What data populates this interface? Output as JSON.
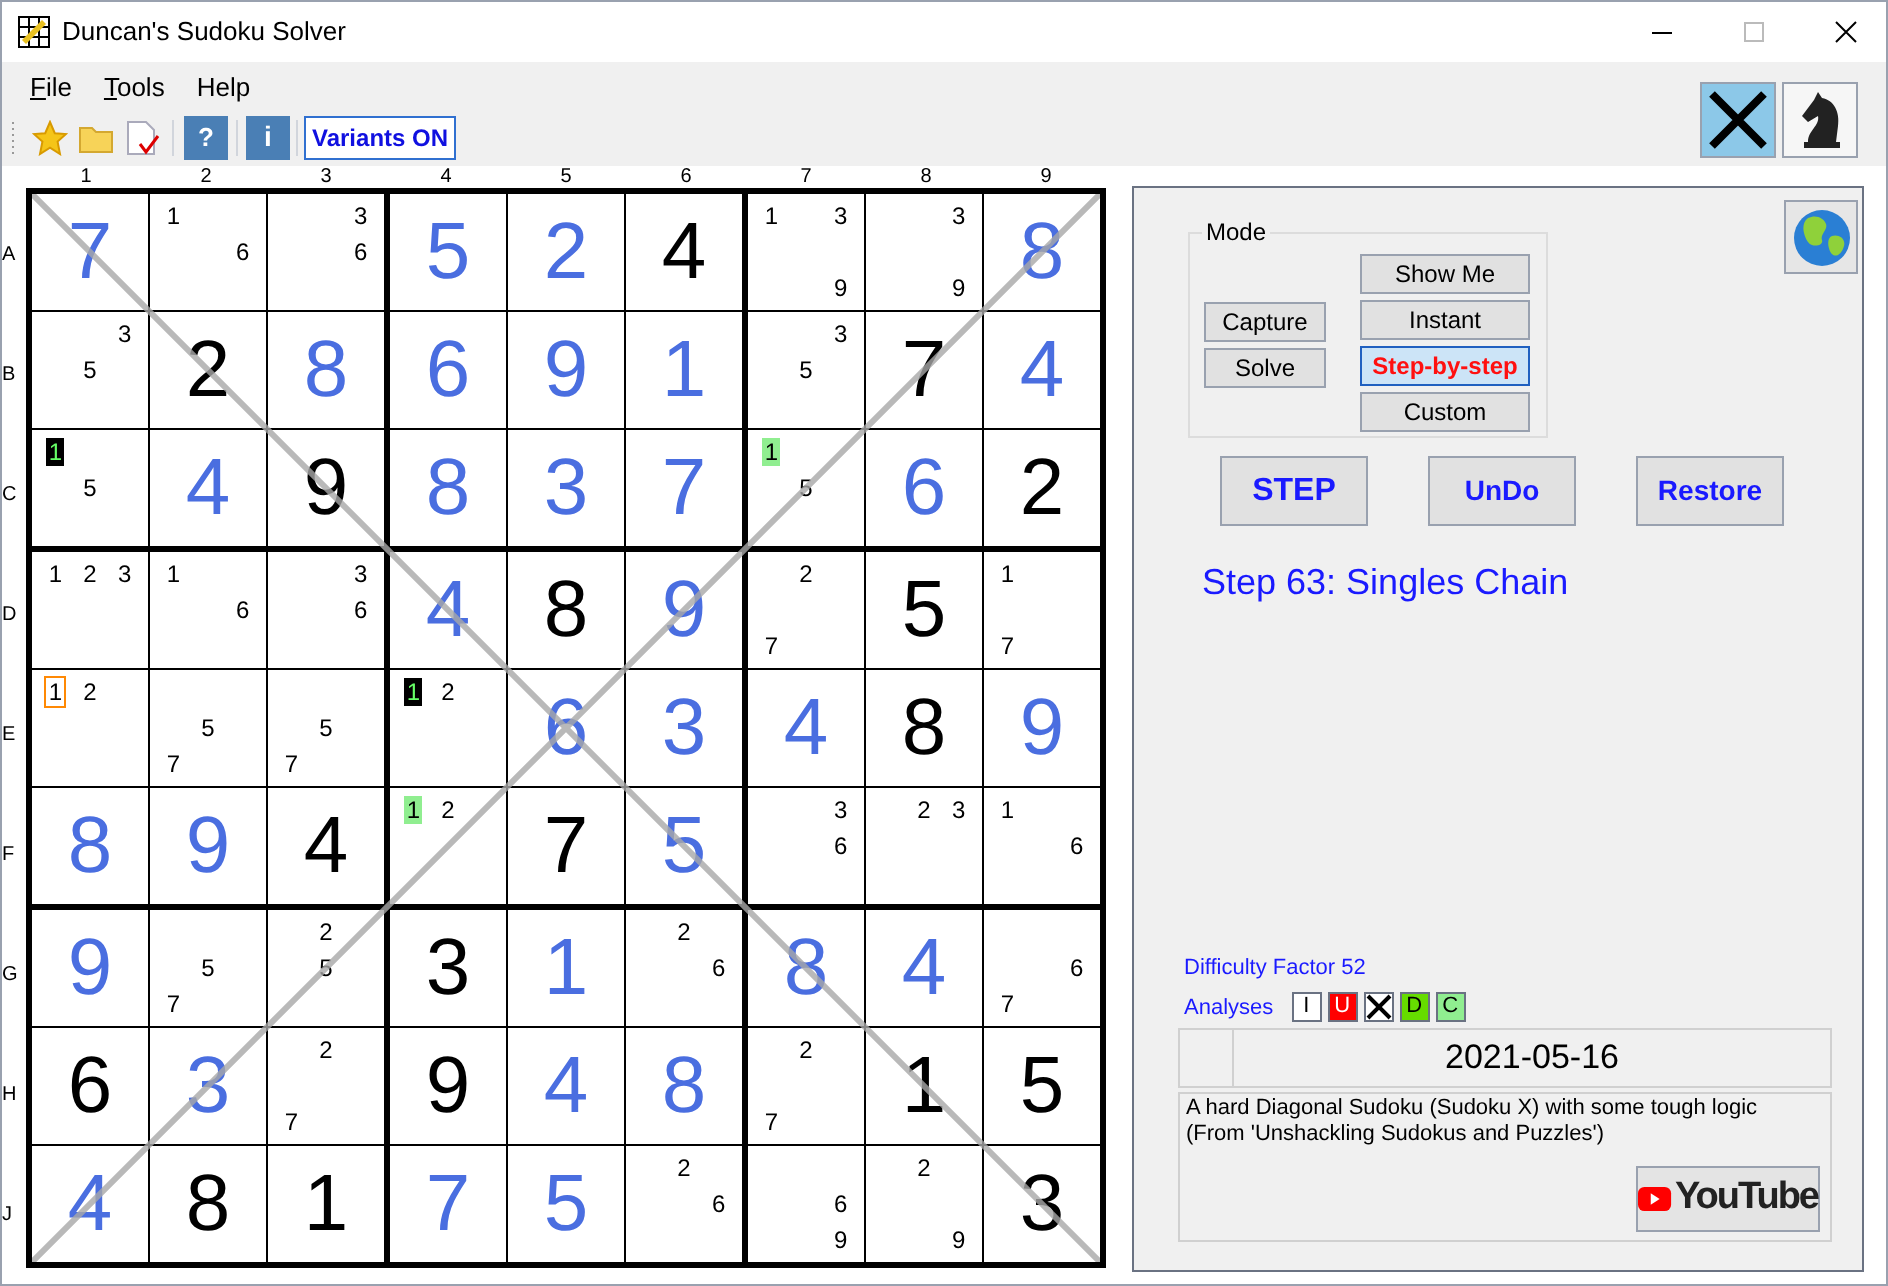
{
  "window": {
    "title": "Duncan's Sudoku Solver"
  },
  "menu": [
    {
      "label": "File",
      "mnemonic": true
    },
    {
      "label": "Tools",
      "mnemonic": true
    },
    {
      "label": "Help",
      "mnemonic": false
    }
  ],
  "toolbar": {
    "help": "?",
    "info": "i",
    "variants": "Variants ON"
  },
  "grid": {
    "column_labels": [
      "1",
      "2",
      "3",
      "4",
      "5",
      "6",
      "7",
      "8",
      "9"
    ],
    "row_labels": [
      "A",
      "B",
      "C",
      "D",
      "E",
      "F",
      "G",
      "H",
      "J"
    ],
    "rows": [
      {
        "cells": [
          {
            "kind": "solved",
            "value": "7"
          },
          {
            "kind": "candidates",
            "candidates": [
              {
                "text": "1",
                "kind": "plain"
              },
              {
                "text": "6",
                "kind": "plain"
              }
            ]
          },
          {
            "kind": "candidates",
            "candidates": [
              {
                "text": "3",
                "kind": "plain"
              },
              {
                "text": "6",
                "kind": "plain"
              }
            ]
          },
          {
            "kind": "solved",
            "value": "5"
          },
          {
            "kind": "solved",
            "value": "2"
          },
          {
            "kind": "given",
            "value": "4"
          },
          {
            "kind": "candidates",
            "candidates": [
              {
                "text": "1",
                "kind": "plain"
              },
              {
                "text": "3",
                "kind": "plain"
              },
              {
                "text": "9",
                "kind": "plain"
              }
            ]
          },
          {
            "kind": "candidates",
            "candidates": [
              {
                "text": "3",
                "kind": "plain"
              },
              {
                "text": "9",
                "kind": "plain"
              }
            ]
          },
          {
            "kind": "solved",
            "value": "8"
          }
        ]
      },
      {
        "cells": [
          {
            "kind": "candidates",
            "candidates": [
              {
                "text": "3",
                "kind": "plain"
              },
              {
                "text": "5",
                "kind": "plain"
              }
            ]
          },
          {
            "kind": "given",
            "value": "2"
          },
          {
            "kind": "solved",
            "value": "8"
          },
          {
            "kind": "solved",
            "value": "6"
          },
          {
            "kind": "solved",
            "value": "9"
          },
          {
            "kind": "solved",
            "value": "1"
          },
          {
            "kind": "candidates",
            "candidates": [
              {
                "text": "3",
                "kind": "plain"
              },
              {
                "text": "5",
                "kind": "plain"
              }
            ]
          },
          {
            "kind": "given",
            "value": "7"
          },
          {
            "kind": "solved",
            "value": "4"
          }
        ]
      },
      {
        "cells": [
          {
            "kind": "candidates",
            "candidates": [
              {
                "text": "1",
                "kind": "dark_highlight"
              },
              {
                "text": "5",
                "kind": "plain"
              }
            ]
          },
          {
            "kind": "solved",
            "value": "4"
          },
          {
            "kind": "given",
            "value": "9"
          },
          {
            "kind": "solved",
            "value": "8"
          },
          {
            "kind": "solved",
            "value": "3"
          },
          {
            "kind": "solved",
            "value": "7"
          },
          {
            "kind": "candidates",
            "candidates": [
              {
                "text": "1",
                "kind": "green_highlight"
              },
              {
                "text": "5",
                "kind": "plain"
              }
            ]
          },
          {
            "kind": "solved",
            "value": "6"
          },
          {
            "kind": "given",
            "value": "2"
          }
        ]
      },
      {
        "cells": [
          {
            "kind": "candidates",
            "candidates": [
              {
                "text": "1",
                "kind": "plain"
              },
              {
                "text": "2",
                "kind": "plain"
              },
              {
                "text": "3",
                "kind": "plain"
              }
            ]
          },
          {
            "kind": "candidates",
            "candidates": [
              {
                "text": "1",
                "kind": "plain"
              },
              {
                "text": "6",
                "kind": "plain"
              }
            ]
          },
          {
            "kind": "candidates",
            "candidates": [
              {
                "text": "3",
                "kind": "plain"
              },
              {
                "text": "6",
                "kind": "plain"
              }
            ]
          },
          {
            "kind": "solved",
            "value": "4"
          },
          {
            "kind": "given",
            "value": "8"
          },
          {
            "kind": "solved",
            "value": "9"
          },
          {
            "kind": "candidates",
            "candidates": [
              {
                "text": "2",
                "kind": "plain"
              },
              {
                "text": "7",
                "kind": "plain"
              }
            ]
          },
          {
            "kind": "given",
            "value": "5"
          },
          {
            "kind": "candidates",
            "candidates": [
              {
                "text": "1",
                "kind": "plain"
              },
              {
                "text": "7",
                "kind": "plain"
              }
            ]
          }
        ]
      },
      {
        "cells": [
          {
            "kind": "candidates",
            "candidates": [
              {
                "text": "1",
                "kind": "outlined"
              },
              {
                "text": "2",
                "kind": "plain"
              }
            ]
          },
          {
            "kind": "candidates",
            "candidates": [
              {
                "text": "5",
                "kind": "plain"
              },
              {
                "text": "7",
                "kind": "plain"
              }
            ]
          },
          {
            "kind": "candidates",
            "candidates": [
              {
                "text": "5",
                "kind": "plain"
              },
              {
                "text": "7",
                "kind": "plain"
              }
            ]
          },
          {
            "kind": "candidates",
            "candidates": [
              {
                "text": "1",
                "kind": "dark_highlight"
              },
              {
                "text": "2",
                "kind": "plain"
              }
            ]
          },
          {
            "kind": "solved",
            "value": "6"
          },
          {
            "kind": "solved",
            "value": "3"
          },
          {
            "kind": "solved",
            "value": "4"
          },
          {
            "kind": "given",
            "value": "8"
          },
          {
            "kind": "solved",
            "value": "9"
          }
        ]
      },
      {
        "cells": [
          {
            "kind": "solved",
            "value": "8"
          },
          {
            "kind": "solved",
            "value": "9"
          },
          {
            "kind": "given",
            "value": "4"
          },
          {
            "kind": "candidates",
            "candidates": [
              {
                "text": "1",
                "kind": "green_highlight"
              },
              {
                "text": "2",
                "kind": "plain"
              }
            ]
          },
          {
            "kind": "given",
            "value": "7"
          },
          {
            "kind": "solved",
            "value": "5"
          },
          {
            "kind": "candidates",
            "candidates": [
              {
                "text": "3",
                "kind": "plain"
              },
              {
                "text": "6",
                "kind": "plain"
              }
            ]
          },
          {
            "kind": "candidates",
            "candidates": [
              {
                "text": "2",
                "kind": "plain"
              },
              {
                "text": "3",
                "kind": "plain"
              }
            ]
          },
          {
            "kind": "candidates",
            "candidates": [
              {
                "text": "1",
                "kind": "plain"
              },
              {
                "text": "6",
                "kind": "plain"
              }
            ]
          }
        ]
      },
      {
        "cells": [
          {
            "kind": "solved",
            "value": "9"
          },
          {
            "kind": "candidates",
            "candidates": [
              {
                "text": "5",
                "kind": "plain"
              },
              {
                "text": "7",
                "kind": "plain"
              }
            ]
          },
          {
            "kind": "candidates",
            "candidates": [
              {
                "text": "2",
                "kind": "plain"
              },
              {
                "text": "5",
                "kind": "plain"
              }
            ]
          },
          {
            "kind": "given",
            "value": "3"
          },
          {
            "kind": "solved",
            "value": "1"
          },
          {
            "kind": "candidates",
            "candidates": [
              {
                "text": "2",
                "kind": "plain"
              },
              {
                "text": "6",
                "kind": "plain"
              }
            ]
          },
          {
            "kind": "solved",
            "value": "8"
          },
          {
            "kind": "solved",
            "value": "4"
          },
          {
            "kind": "candidates",
            "candidates": [
              {
                "text": "6",
                "kind": "plain"
              },
              {
                "text": "7",
                "kind": "plain"
              }
            ]
          }
        ]
      },
      {
        "cells": [
          {
            "kind": "given",
            "value": "6"
          },
          {
            "kind": "solved",
            "value": "3"
          },
          {
            "kind": "candidates",
            "candidates": [
              {
                "text": "2",
                "kind": "plain"
              },
              {
                "text": "7",
                "kind": "plain"
              }
            ]
          },
          {
            "kind": "given",
            "value": "9"
          },
          {
            "kind": "solved",
            "value": "4"
          },
          {
            "kind": "solved",
            "value": "8"
          },
          {
            "kind": "candidates",
            "candidates": [
              {
                "text": "2",
                "kind": "plain"
              },
              {
                "text": "7",
                "kind": "plain"
              }
            ]
          },
          {
            "kind": "given",
            "value": "1"
          },
          {
            "kind": "given",
            "value": "5"
          }
        ]
      },
      {
        "cells": [
          {
            "kind": "solved",
            "value": "4"
          },
          {
            "kind": "given",
            "value": "8"
          },
          {
            "kind": "given",
            "value": "1"
          },
          {
            "kind": "solved",
            "value": "7"
          },
          {
            "kind": "solved",
            "value": "5"
          },
          {
            "kind": "candidates",
            "candidates": [
              {
                "text": "2",
                "kind": "plain"
              },
              {
                "text": "6",
                "kind": "plain"
              }
            ]
          },
          {
            "kind": "candidates",
            "candidates": [
              {
                "text": "6",
                "kind": "plain"
              },
              {
                "text": "9",
                "kind": "plain"
              }
            ]
          },
          {
            "kind": "candidates",
            "candidates": [
              {
                "text": "2",
                "kind": "plain"
              },
              {
                "text": "9",
                "kind": "plain"
              }
            ]
          },
          {
            "kind": "given",
            "value": "3"
          }
        ]
      }
    ]
  },
  "panel": {
    "mode": {
      "legend": "Mode",
      "actions": [
        "Capture",
        "Solve"
      ],
      "options": [
        {
          "label": "Show Me",
          "selected": false
        },
        {
          "label": "Instant",
          "selected": false
        },
        {
          "label": "Step-by-step",
          "selected": true
        },
        {
          "label": "Custom",
          "selected": false
        }
      ]
    },
    "buttons": [
      "STEP",
      "UnDo",
      "Restore"
    ],
    "step_text": "Step 63: Singles Chain",
    "difficulty": "Difficulty Factor 52",
    "analyses": {
      "label": "Analyses",
      "items": [
        {
          "kind": "letter",
          "text": "I",
          "color": "#ffffff"
        },
        {
          "kind": "letter",
          "text": "U",
          "color": "#ff0000"
        },
        {
          "kind": "cross",
          "color": "#ffffff"
        },
        {
          "kind": "letter",
          "text": "D",
          "color": "#66dd00"
        },
        {
          "kind": "letter",
          "text": "C",
          "color": "#90ee90"
        }
      ]
    },
    "date": "2021-05-16",
    "description": [
      "A hard Diagonal Sudoku (Sudoku X) with some tough logic",
      "(From 'Unshackling Sudokus and Puzzles')"
    ],
    "youtube": "YouTube"
  }
}
